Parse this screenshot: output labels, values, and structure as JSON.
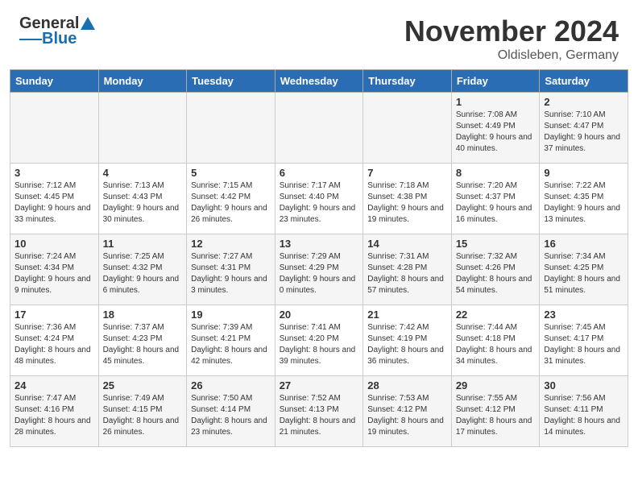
{
  "header": {
    "logo_general": "General",
    "logo_blue": "Blue",
    "month_title": "November 2024",
    "location": "Oldisleben, Germany"
  },
  "days_of_week": [
    "Sunday",
    "Monday",
    "Tuesday",
    "Wednesday",
    "Thursday",
    "Friday",
    "Saturday"
  ],
  "weeks": [
    [
      {
        "day": "",
        "info": ""
      },
      {
        "day": "",
        "info": ""
      },
      {
        "day": "",
        "info": ""
      },
      {
        "day": "",
        "info": ""
      },
      {
        "day": "",
        "info": ""
      },
      {
        "day": "1",
        "info": "Sunrise: 7:08 AM\nSunset: 4:49 PM\nDaylight: 9 hours and 40 minutes."
      },
      {
        "day": "2",
        "info": "Sunrise: 7:10 AM\nSunset: 4:47 PM\nDaylight: 9 hours and 37 minutes."
      }
    ],
    [
      {
        "day": "3",
        "info": "Sunrise: 7:12 AM\nSunset: 4:45 PM\nDaylight: 9 hours and 33 minutes."
      },
      {
        "day": "4",
        "info": "Sunrise: 7:13 AM\nSunset: 4:43 PM\nDaylight: 9 hours and 30 minutes."
      },
      {
        "day": "5",
        "info": "Sunrise: 7:15 AM\nSunset: 4:42 PM\nDaylight: 9 hours and 26 minutes."
      },
      {
        "day": "6",
        "info": "Sunrise: 7:17 AM\nSunset: 4:40 PM\nDaylight: 9 hours and 23 minutes."
      },
      {
        "day": "7",
        "info": "Sunrise: 7:18 AM\nSunset: 4:38 PM\nDaylight: 9 hours and 19 minutes."
      },
      {
        "day": "8",
        "info": "Sunrise: 7:20 AM\nSunset: 4:37 PM\nDaylight: 9 hours and 16 minutes."
      },
      {
        "day": "9",
        "info": "Sunrise: 7:22 AM\nSunset: 4:35 PM\nDaylight: 9 hours and 13 minutes."
      }
    ],
    [
      {
        "day": "10",
        "info": "Sunrise: 7:24 AM\nSunset: 4:34 PM\nDaylight: 9 hours and 9 minutes."
      },
      {
        "day": "11",
        "info": "Sunrise: 7:25 AM\nSunset: 4:32 PM\nDaylight: 9 hours and 6 minutes."
      },
      {
        "day": "12",
        "info": "Sunrise: 7:27 AM\nSunset: 4:31 PM\nDaylight: 9 hours and 3 minutes."
      },
      {
        "day": "13",
        "info": "Sunrise: 7:29 AM\nSunset: 4:29 PM\nDaylight: 9 hours and 0 minutes."
      },
      {
        "day": "14",
        "info": "Sunrise: 7:31 AM\nSunset: 4:28 PM\nDaylight: 8 hours and 57 minutes."
      },
      {
        "day": "15",
        "info": "Sunrise: 7:32 AM\nSunset: 4:26 PM\nDaylight: 8 hours and 54 minutes."
      },
      {
        "day": "16",
        "info": "Sunrise: 7:34 AM\nSunset: 4:25 PM\nDaylight: 8 hours and 51 minutes."
      }
    ],
    [
      {
        "day": "17",
        "info": "Sunrise: 7:36 AM\nSunset: 4:24 PM\nDaylight: 8 hours and 48 minutes."
      },
      {
        "day": "18",
        "info": "Sunrise: 7:37 AM\nSunset: 4:23 PM\nDaylight: 8 hours and 45 minutes."
      },
      {
        "day": "19",
        "info": "Sunrise: 7:39 AM\nSunset: 4:21 PM\nDaylight: 8 hours and 42 minutes."
      },
      {
        "day": "20",
        "info": "Sunrise: 7:41 AM\nSunset: 4:20 PM\nDaylight: 8 hours and 39 minutes."
      },
      {
        "day": "21",
        "info": "Sunrise: 7:42 AM\nSunset: 4:19 PM\nDaylight: 8 hours and 36 minutes."
      },
      {
        "day": "22",
        "info": "Sunrise: 7:44 AM\nSunset: 4:18 PM\nDaylight: 8 hours and 34 minutes."
      },
      {
        "day": "23",
        "info": "Sunrise: 7:45 AM\nSunset: 4:17 PM\nDaylight: 8 hours and 31 minutes."
      }
    ],
    [
      {
        "day": "24",
        "info": "Sunrise: 7:47 AM\nSunset: 4:16 PM\nDaylight: 8 hours and 28 minutes."
      },
      {
        "day": "25",
        "info": "Sunrise: 7:49 AM\nSunset: 4:15 PM\nDaylight: 8 hours and 26 minutes."
      },
      {
        "day": "26",
        "info": "Sunrise: 7:50 AM\nSunset: 4:14 PM\nDaylight: 8 hours and 23 minutes."
      },
      {
        "day": "27",
        "info": "Sunrise: 7:52 AM\nSunset: 4:13 PM\nDaylight: 8 hours and 21 minutes."
      },
      {
        "day": "28",
        "info": "Sunrise: 7:53 AM\nSunset: 4:12 PM\nDaylight: 8 hours and 19 minutes."
      },
      {
        "day": "29",
        "info": "Sunrise: 7:55 AM\nSunset: 4:12 PM\nDaylight: 8 hours and 17 minutes."
      },
      {
        "day": "30",
        "info": "Sunrise: 7:56 AM\nSunset: 4:11 PM\nDaylight: 8 hours and 14 minutes."
      }
    ]
  ]
}
